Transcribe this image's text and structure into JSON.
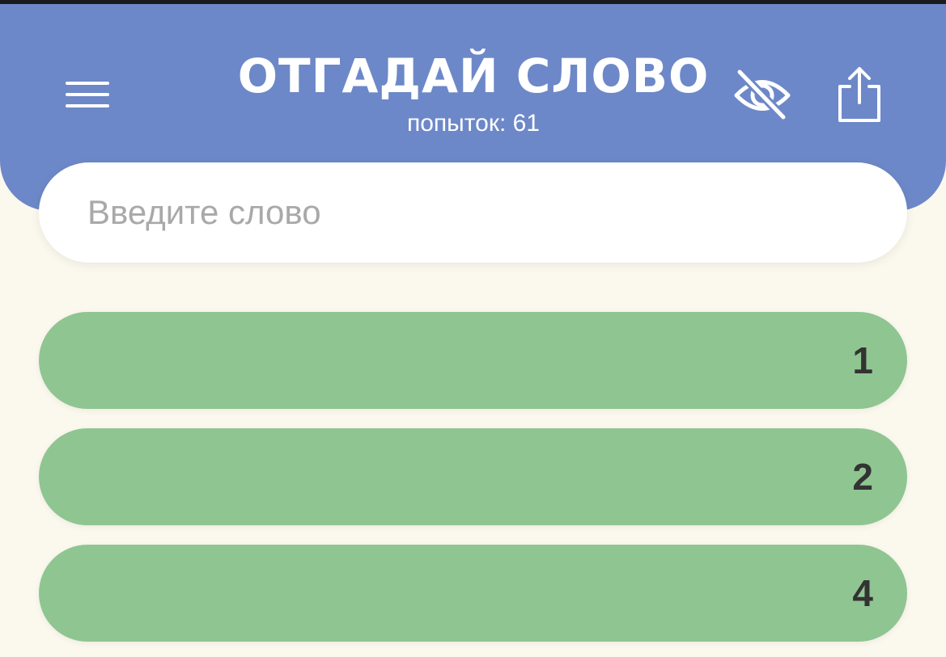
{
  "header": {
    "title": "ОТГАДАЙ СЛОВО",
    "attempts_text": "попыток: 61",
    "menu_icon": "hamburger-menu-icon",
    "hide_icon": "eye-slash-icon",
    "share_icon": "share-icon"
  },
  "search": {
    "placeholder": "Введите слово",
    "value": ""
  },
  "guesses": [
    {
      "word": "",
      "rank": "1"
    },
    {
      "word": "",
      "rank": "2"
    },
    {
      "word": "",
      "rank": "4"
    }
  ],
  "colors": {
    "header": "#6d88c8",
    "background": "#fbf8ee",
    "guess_row": "#8fc591",
    "input": "#ffffff"
  }
}
